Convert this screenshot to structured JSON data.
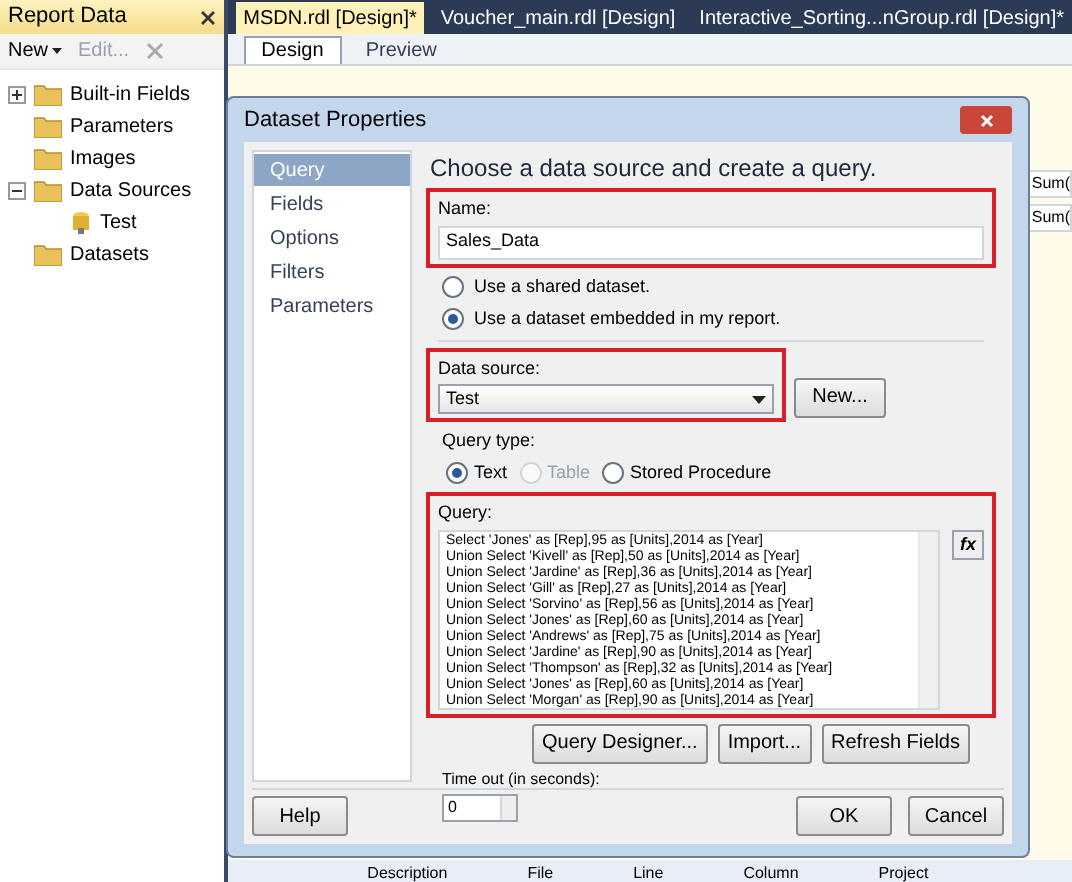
{
  "report_data": {
    "title": "Report Data",
    "toolbar": [
      "New",
      "Edit..."
    ],
    "tree": [
      {
        "label": "Built-in Fields",
        "kind": "folder",
        "expanded": false
      },
      {
        "label": "Parameters",
        "kind": "folder"
      },
      {
        "label": "Images",
        "kind": "folder"
      },
      {
        "label": "Data Sources",
        "kind": "folder",
        "expanded": true,
        "children": [
          {
            "label": "Test",
            "kind": "source"
          }
        ]
      },
      {
        "label": "Datasets",
        "kind": "folder"
      }
    ]
  },
  "doc_tabs": [
    {
      "label": "MSDN.rdl [Design]*",
      "selected": true
    },
    {
      "label": "Voucher_main.rdl [Design]",
      "selected": false
    },
    {
      "label": "Interactive_Sorting...nGroup.rdl [Design]*",
      "selected": false
    }
  ],
  "view_tabs": [
    {
      "label": "Design",
      "selected": true
    },
    {
      "label": "Preview",
      "selected": false
    }
  ],
  "canvas_cells": [
    "Sum(",
    "Sum("
  ],
  "error_list_columns": [
    "Description",
    "File",
    "Line",
    "Column",
    "Project"
  ],
  "dialog": {
    "title": "Dataset Properties",
    "nav": [
      {
        "label": "Query",
        "selected": true
      },
      {
        "label": "Fields",
        "selected": false
      },
      {
        "label": "Options",
        "selected": false
      },
      {
        "label": "Filters",
        "selected": false
      },
      {
        "label": "Parameters",
        "selected": false
      }
    ],
    "heading": "Choose a data source and create a query.",
    "name_label": "Name:",
    "name_value": "Sales_Data",
    "dataset_options": [
      {
        "label": "Use a shared dataset.",
        "selected": false
      },
      {
        "label": "Use a dataset embedded in my report.",
        "selected": true
      }
    ],
    "data_source_label": "Data source:",
    "data_source_value": "Test",
    "new_button": "New...",
    "query_type_label": "Query type:",
    "query_types": [
      {
        "label": "Text",
        "selected": true,
        "disabled": false
      },
      {
        "label": "Table",
        "selected": false,
        "disabled": true
      },
      {
        "label": "Stored Procedure",
        "selected": false,
        "disabled": false
      }
    ],
    "query_label": "Query:",
    "expression_button": "fx",
    "query_lines": [
      "Select 'Jones' as [Rep],95 as [Units],2014 as [Year]",
      "Union Select 'Kivell' as [Rep],50 as [Units],2014 as [Year]",
      "Union Select 'Jardine' as [Rep],36 as [Units],2014 as [Year]",
      "Union Select 'Gill' as [Rep],27 as [Units],2014 as [Year]",
      "Union Select 'Sorvino' as [Rep],56 as [Units],2014 as [Year]",
      "Union Select 'Jones' as [Rep],60 as [Units],2014 as [Year]",
      "Union Select 'Andrews' as [Rep],75 as [Units],2014 as [Year]",
      "Union Select 'Jardine' as [Rep],90 as [Units],2014 as [Year]",
      "Union Select 'Thompson' as [Rep],32 as [Units],2014 as [Year]",
      "Union Select 'Jones' as [Rep],60 as [Units],2014 as [Year]",
      "Union Select 'Morgan' as [Rep],90 as [Units],2014 as [Year]"
    ],
    "query_buttons": [
      "Query Designer...",
      "Import...",
      "Refresh Fields"
    ],
    "timeout_label": "Time out (in seconds):",
    "timeout_value": "0",
    "help_button": "Help",
    "ok_button": "OK",
    "cancel_button": "Cancel"
  }
}
